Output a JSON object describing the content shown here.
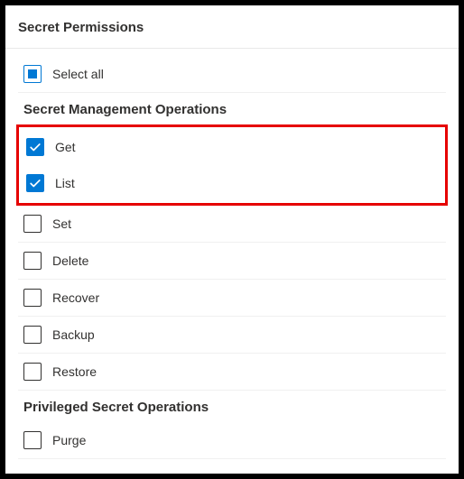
{
  "header": {
    "title": "Secret Permissions"
  },
  "select_all": {
    "label": "Select all"
  },
  "sections": {
    "management": {
      "heading": "Secret Management Operations",
      "items": {
        "get": "Get",
        "list": "List",
        "set": "Set",
        "delete": "Delete",
        "recover": "Recover",
        "backup": "Backup",
        "restore": "Restore"
      }
    },
    "privileged": {
      "heading": "Privileged Secret Operations",
      "items": {
        "purge": "Purge"
      }
    }
  }
}
